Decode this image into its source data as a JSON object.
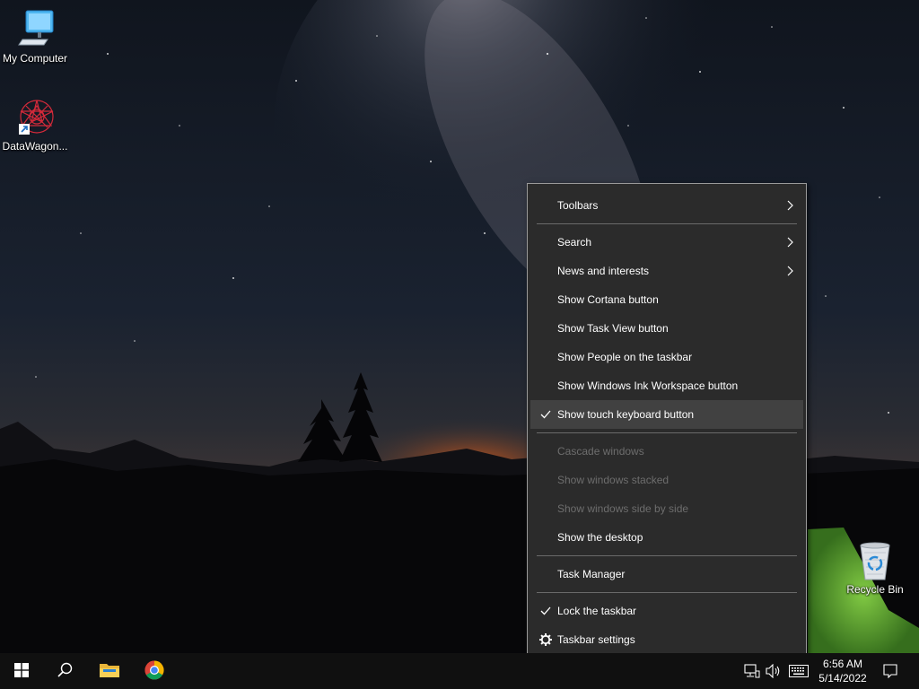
{
  "desktop": {
    "icons": [
      {
        "label": "My Computer",
        "icon": "computer-icon"
      },
      {
        "label": "DataWagon...",
        "icon": "datawagon-shortcut-icon"
      },
      {
        "label": "Recycle Bin",
        "icon": "recycle-bin-icon"
      }
    ]
  },
  "context_menu": {
    "items": [
      {
        "label": "Toolbars",
        "submenu": true,
        "checked": false,
        "disabled": false
      },
      {
        "label": "Search",
        "submenu": true,
        "checked": false,
        "disabled": false
      },
      {
        "label": "News and interests",
        "submenu": true,
        "checked": false,
        "disabled": false
      },
      {
        "label": "Show Cortana button",
        "submenu": false,
        "checked": false,
        "disabled": false
      },
      {
        "label": "Show Task View button",
        "submenu": false,
        "checked": false,
        "disabled": false
      },
      {
        "label": "Show People on the taskbar",
        "submenu": false,
        "checked": false,
        "disabled": false
      },
      {
        "label": "Show Windows Ink Workspace button",
        "submenu": false,
        "checked": false,
        "disabled": false
      },
      {
        "label": "Show touch keyboard button",
        "submenu": false,
        "checked": true,
        "disabled": false,
        "hovered": true
      },
      {
        "label": "Cascade windows",
        "submenu": false,
        "checked": false,
        "disabled": true
      },
      {
        "label": "Show windows stacked",
        "submenu": false,
        "checked": false,
        "disabled": true
      },
      {
        "label": "Show windows side by side",
        "submenu": false,
        "checked": false,
        "disabled": true
      },
      {
        "label": "Show the desktop",
        "submenu": false,
        "checked": false,
        "disabled": false
      },
      {
        "label": "Task Manager",
        "submenu": false,
        "checked": false,
        "disabled": false
      },
      {
        "label": "Lock the taskbar",
        "submenu": false,
        "checked": true,
        "disabled": false
      },
      {
        "label": "Taskbar settings",
        "submenu": false,
        "checked": false,
        "disabled": false,
        "icon": "gear-icon"
      }
    ],
    "colors": {
      "background": "#2b2b2b",
      "hover": "#414141",
      "disabled_text": "#6d6d6d",
      "border": "#9a9a9a"
    }
  },
  "taskbar": {
    "pinned": [
      {
        "name": "start-button",
        "icon": "windows-logo-icon"
      },
      {
        "name": "search-button",
        "icon": "search-icon"
      },
      {
        "name": "file-explorer-button",
        "icon": "folder-icon"
      },
      {
        "name": "chrome-button",
        "icon": "chrome-icon"
      }
    ],
    "tray": {
      "icons": [
        "network-icon",
        "volume-icon",
        "touch-keyboard-icon"
      ],
      "time": "6:56 AM",
      "date": "5/14/2022",
      "notification_icon": "action-center-icon"
    }
  }
}
